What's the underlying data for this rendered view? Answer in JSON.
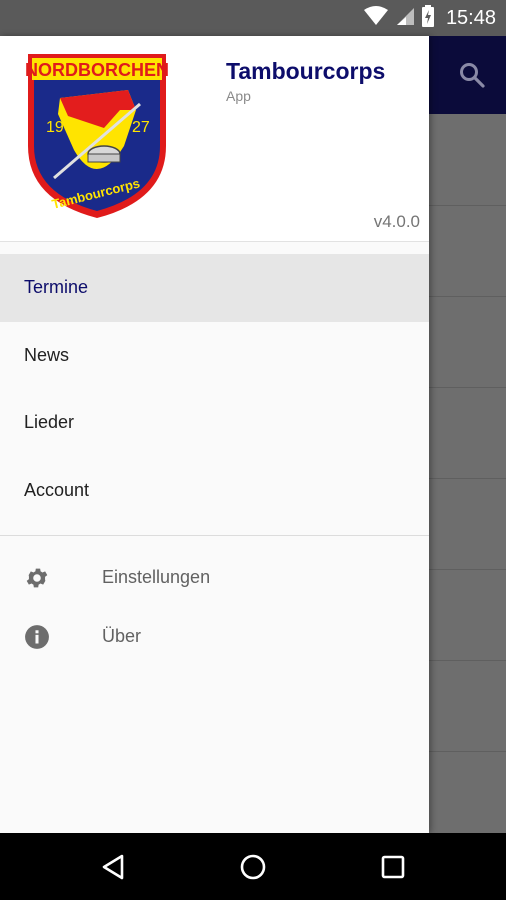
{
  "status_bar": {
    "time": "15:48"
  },
  "drawer": {
    "header": {
      "title": "Tambourcorps",
      "subtitle": "App",
      "version": "v4.0.0",
      "logo": {
        "top_text": "NORDBORCHEN",
        "year_left": "19",
        "year_right": "27",
        "bottom_text": "Tambourcorps",
        "colors": {
          "border": "#e01b1b",
          "field": "#1a2a8a",
          "yellow": "#ffe400",
          "red": "#e31d1d"
        }
      }
    },
    "menu": [
      {
        "label": "Termine",
        "active": true
      },
      {
        "label": "News",
        "active": false
      },
      {
        "label": "Lieder",
        "active": false
      },
      {
        "label": "Account",
        "active": false
      }
    ],
    "secondary": [
      {
        "label": "Einstellungen",
        "icon": "gear-icon"
      },
      {
        "label": "Über",
        "icon": "info-icon"
      }
    ]
  },
  "colors": {
    "accent": "#0d0d6b",
    "toolbar": "#0b0b3a"
  }
}
